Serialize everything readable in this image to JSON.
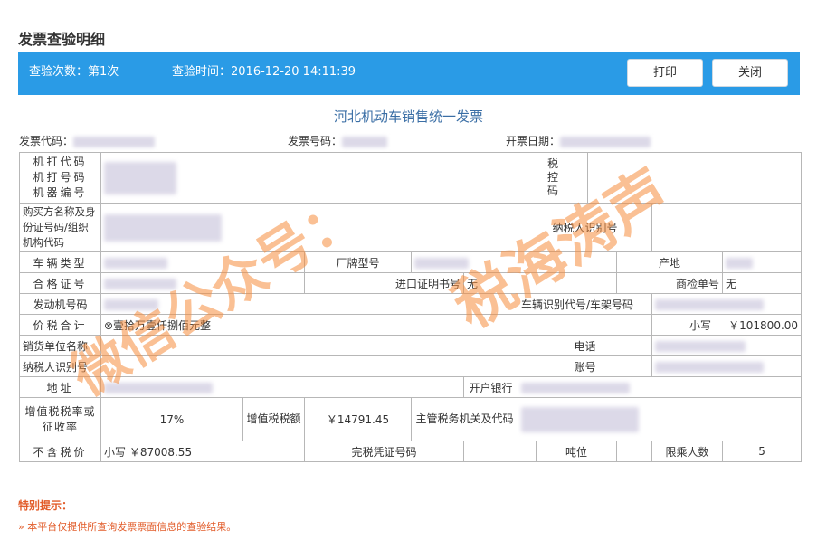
{
  "page_title": "发票查验明细",
  "bar": {
    "check_count": "查验次数：第1次",
    "check_time": "查验时间：2016-12-20 14:11:39",
    "print_label": "打印",
    "close_label": "关闭"
  },
  "invoice": {
    "title": "河北机动车销售统一发票",
    "code_label": "发票代码：",
    "number_label": "发票号码：",
    "date_label": "开票日期："
  },
  "table": {
    "machine_code": "机打代码",
    "machine_number": "机打号码",
    "machine_serial": "机器编号",
    "tax_control": "税控码",
    "buyer": "购买方名称及身份证号码/组织机构代码",
    "buyer_tax_id": "纳税人识别号",
    "vehicle_type": "车辆类型",
    "brand_model": "厂牌型号",
    "origin": "产地",
    "cert_no": "合格证号",
    "import_cert": "进口证明书号",
    "import_cert_value": "无",
    "inspection_no": "商检单号",
    "inspection_value": "无",
    "engine_no": "发动机号码",
    "vin": "车辆识别代号/车架号码",
    "total_label": "价税合计",
    "total_caps": "⊗壹拾万壹仟捌佰元整",
    "total_small_label": "小写",
    "total_small": "￥101800.00",
    "seller": "销货单位名称",
    "phone": "电话",
    "seller_tax_id": "纳税人识别号",
    "account": "账号",
    "address": "地址",
    "bank": "开户银行",
    "vat_rate_label": "增值税税率或征收率",
    "vat_rate": "17%",
    "vat_amount_label": "增值税税额",
    "vat_amount": "￥14791.45",
    "tax_authority": "主管税务机关及代码",
    "price_ex_tax": "不含税价",
    "price_ex_tax_value": "小写 ￥87008.55",
    "tax_cert": "完税凭证号码",
    "tonnage": "吨位",
    "seats_label": "限乘人数",
    "seats": "5"
  },
  "tips": {
    "title": "特别提示：",
    "item1": "» 本平台仅提供所查询发票票面信息的查验结果。"
  },
  "watermark": {
    "text1": "微信公众号：",
    "text2": "税海涛声"
  }
}
